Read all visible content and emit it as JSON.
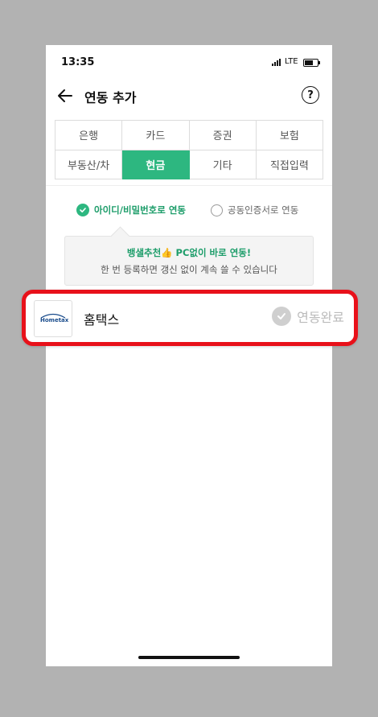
{
  "status": {
    "time": "13:35",
    "network": "LTE",
    "battery_level": 0.65
  },
  "header": {
    "title": "연동 추가",
    "help": "?"
  },
  "tabs": [
    {
      "label": "은행",
      "active": false
    },
    {
      "label": "카드",
      "active": false
    },
    {
      "label": "증권",
      "active": false
    },
    {
      "label": "보험",
      "active": false
    },
    {
      "label": "부동산/차",
      "active": false
    },
    {
      "label": "현금",
      "active": true
    },
    {
      "label": "기타",
      "active": false
    },
    {
      "label": "직접입력",
      "active": false
    }
  ],
  "options": {
    "id_password": "아이디/비밀번호로 연동",
    "certificate": "공동인증서로 연동"
  },
  "tip": {
    "line1": "뱅샐추천👍 PC없이 바로 연동!",
    "line2": "한 번 등록하면 갱신 없이 계속 쓸 수 있습니다"
  },
  "item": {
    "logo_text": "Hometax",
    "name": "홈택스",
    "status": "연동완료"
  },
  "colors": {
    "accent": "#2db780",
    "highlight": "#e8111a"
  }
}
